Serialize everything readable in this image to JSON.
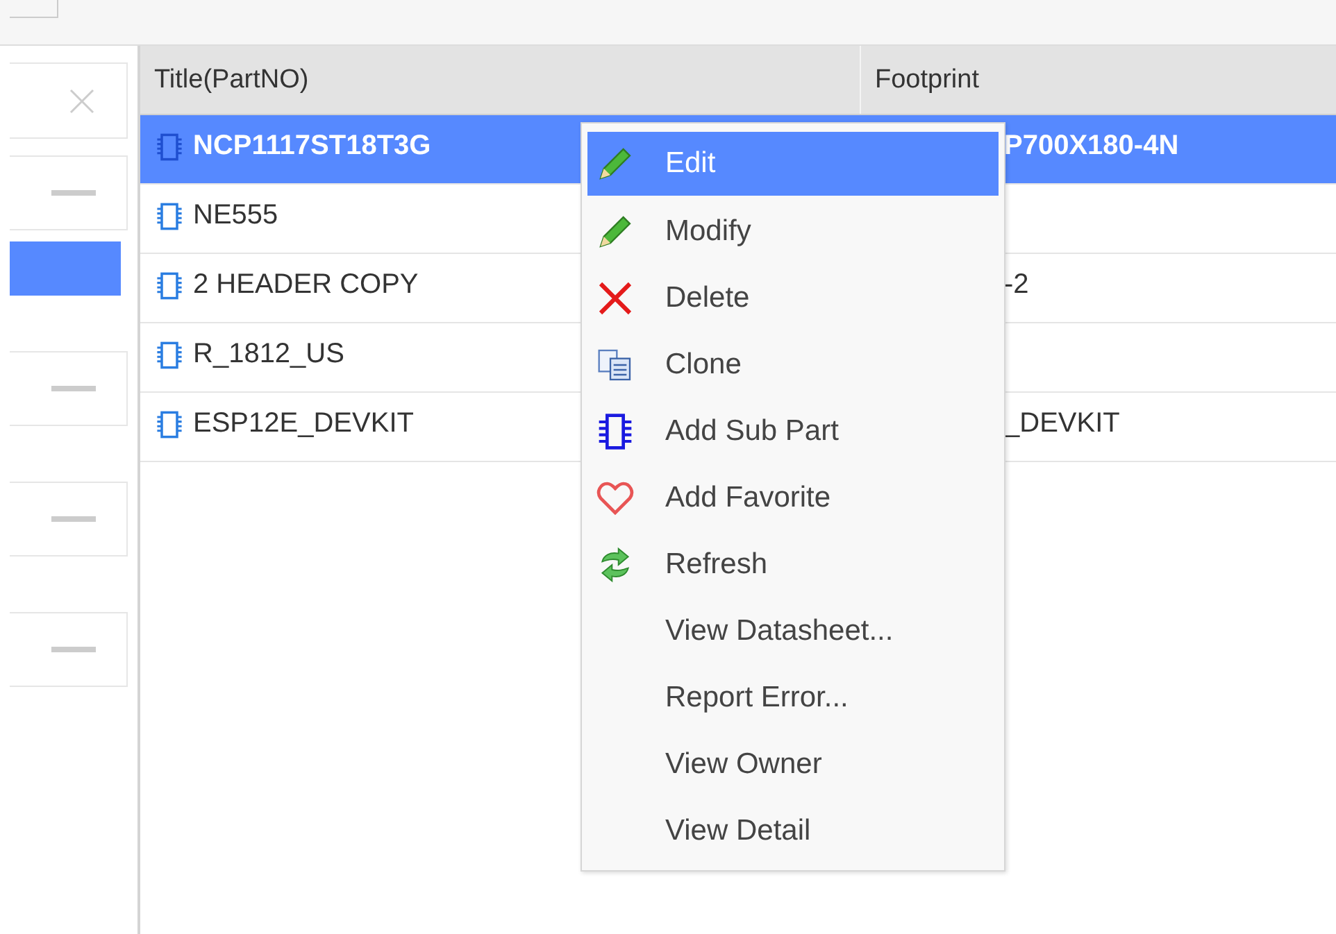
{
  "left_panel": {
    "items": [
      {
        "kind": "close"
      },
      {
        "kind": "collapse"
      },
      {
        "kind": "highlight"
      },
      {
        "kind": "collapse"
      },
      {
        "kind": "collapse"
      },
      {
        "kind": "collapse"
      }
    ]
  },
  "table": {
    "columns": [
      "Title(PartNO)",
      "Footprint"
    ],
    "rows": [
      {
        "title": "NCP1117ST18T3G",
        "footprint": "P700X180-4N",
        "selected": true
      },
      {
        "title": "NE555",
        "selected": false
      },
      {
        "title": "2 HEADER COPY",
        "footprint": "-2",
        "selected": false
      },
      {
        "title": "R_1812_US",
        "selected": false
      },
      {
        "title": "ESP12E_DEVKIT",
        "footprint": "_DEVKIT",
        "selected": false
      }
    ]
  },
  "context_menu": {
    "items": [
      {
        "label": "Edit",
        "kind": "pencil",
        "selected": true
      },
      {
        "label": "Modify",
        "kind": "pencil",
        "selected": false
      },
      {
        "label": "Delete",
        "kind": "cross",
        "selected": false
      },
      {
        "label": "Clone",
        "kind": "documents",
        "selected": false
      },
      {
        "label": "Add Sub Part",
        "kind": "chip",
        "selected": false
      },
      {
        "label": "Add Favorite",
        "kind": "heart",
        "selected": false
      },
      {
        "label": "Refresh",
        "kind": "arrows",
        "selected": false
      },
      {
        "label": "View Datasheet...",
        "kind": "plain",
        "selected": false
      },
      {
        "label": "Report Error...",
        "kind": "plain",
        "selected": false
      },
      {
        "label": "View Owner",
        "kind": "plain",
        "selected": false
      },
      {
        "label": "View Detail",
        "kind": "plain",
        "selected": false
      }
    ]
  }
}
